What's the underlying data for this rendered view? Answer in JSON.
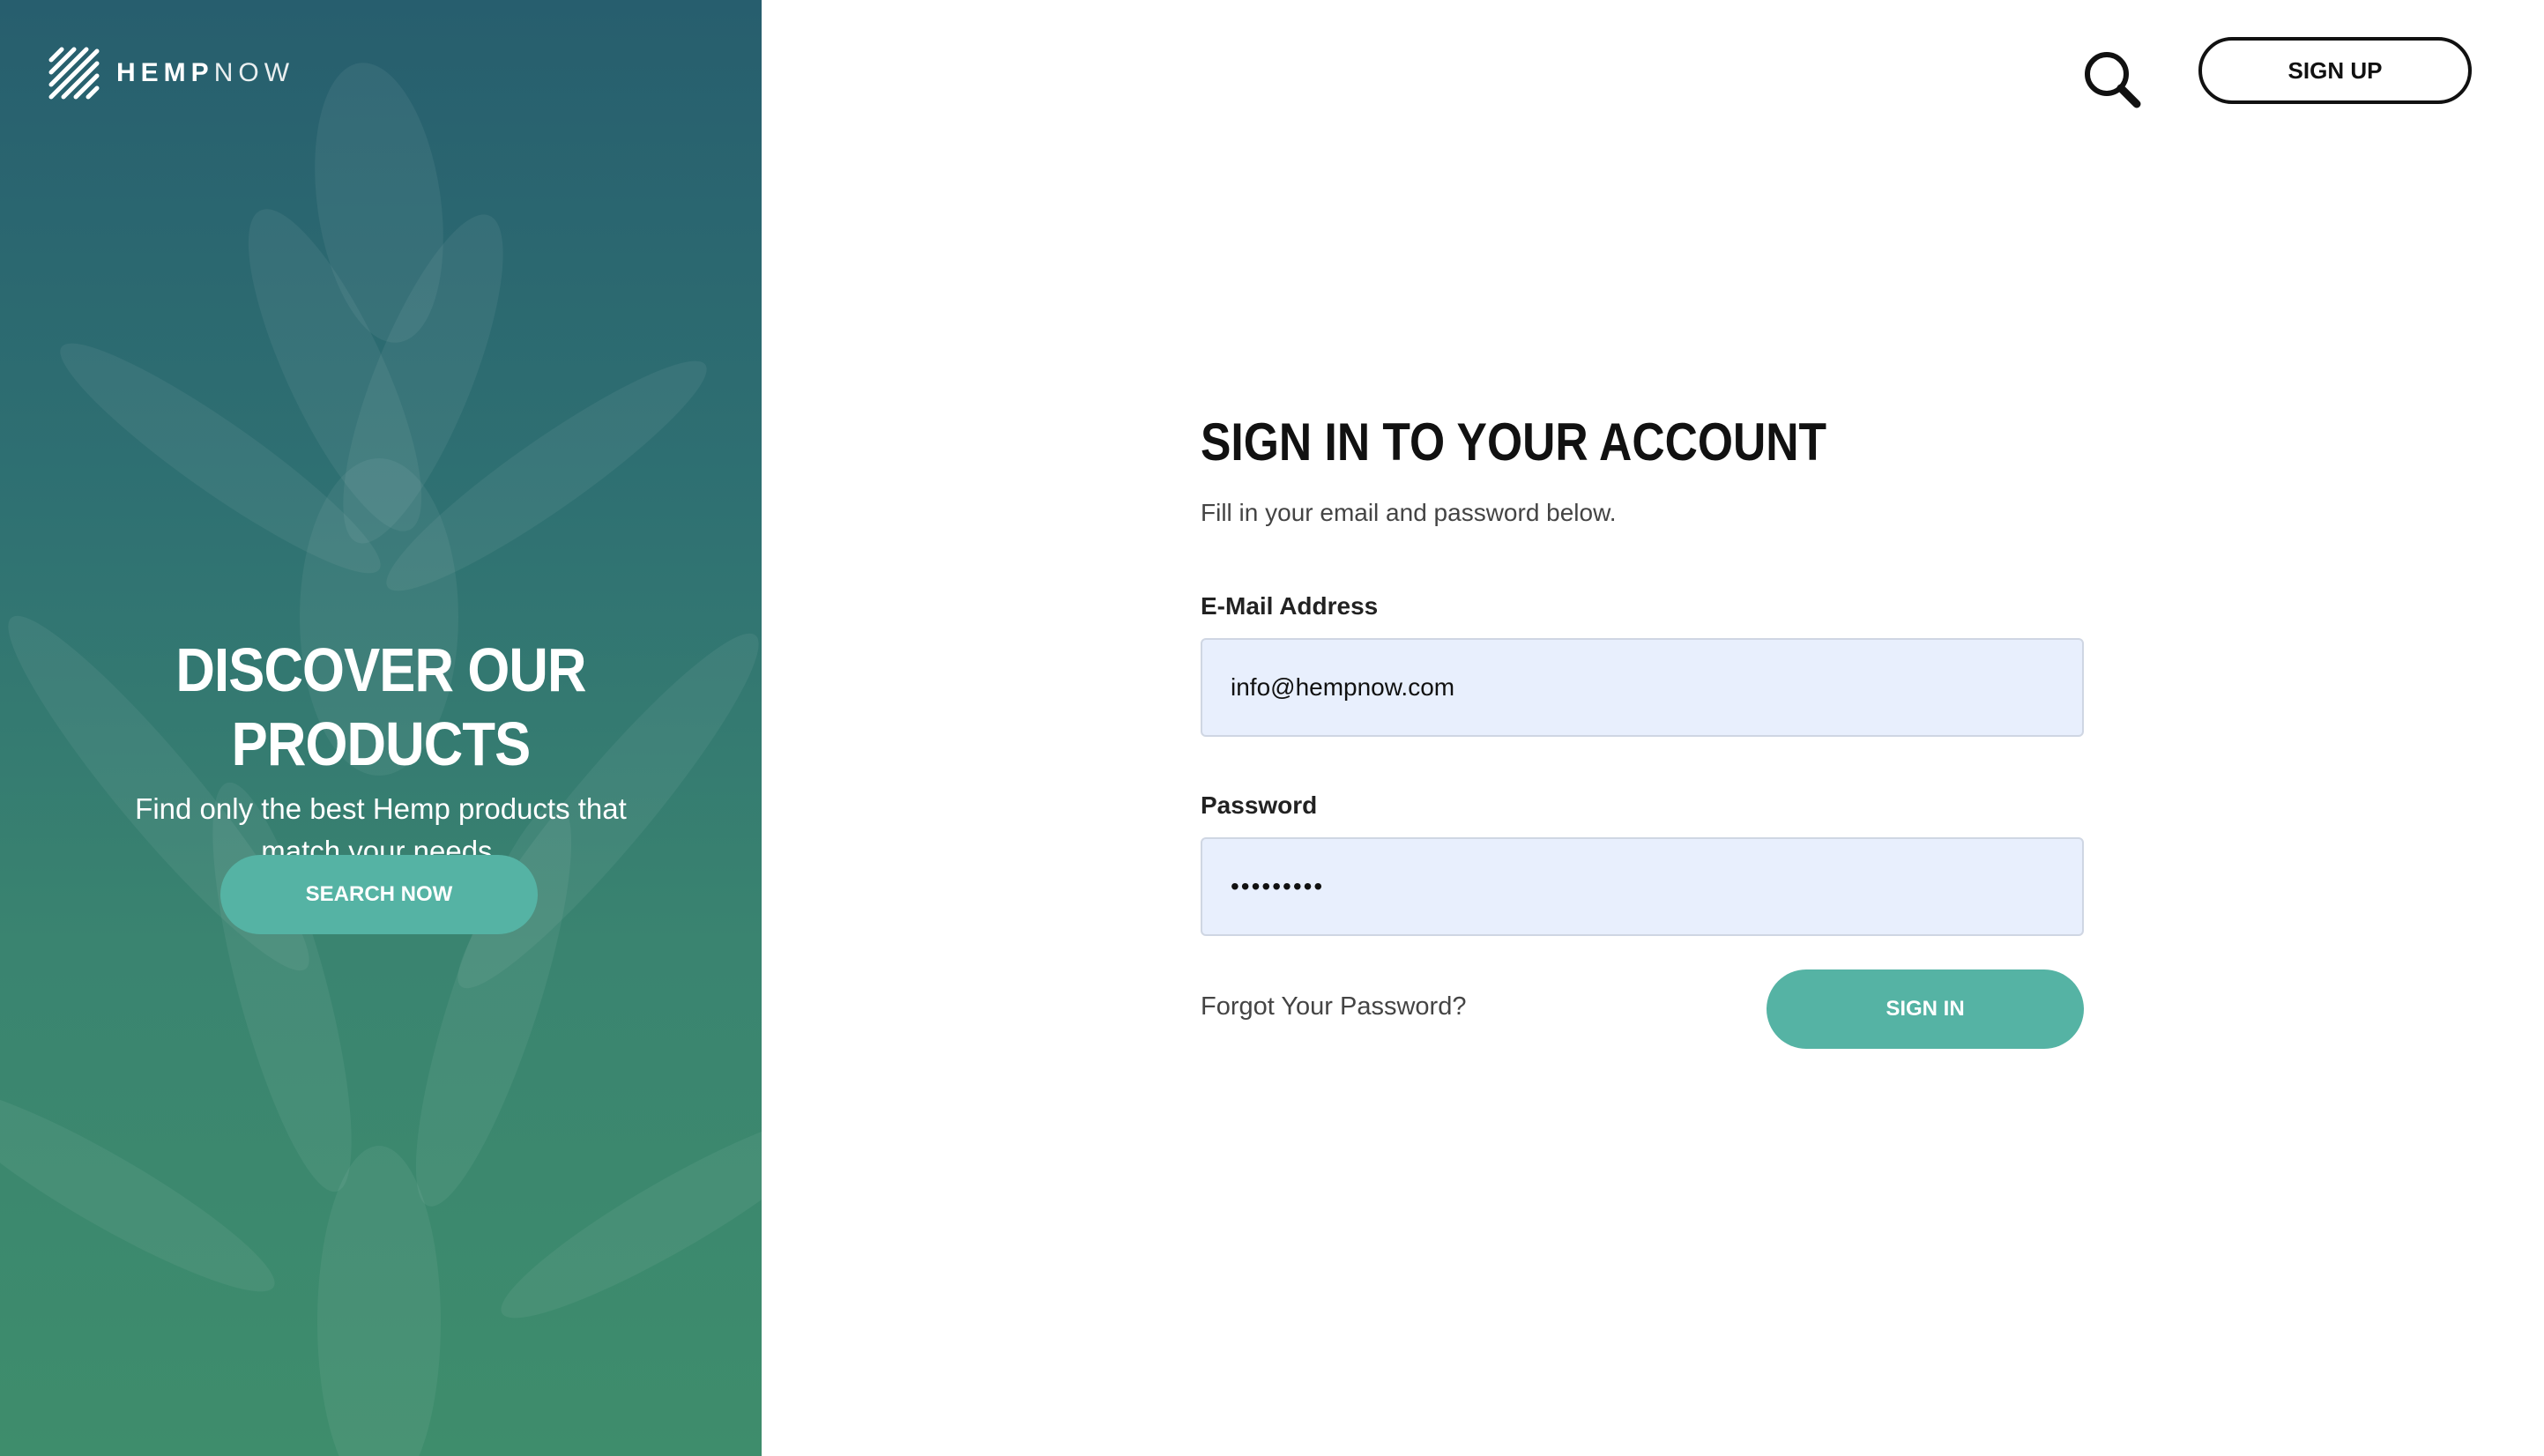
{
  "brand": {
    "name_bold": "HEMP",
    "name_light": "NOW",
    "logo_icon": "hempnow-stripes-logo"
  },
  "hero": {
    "title": "DISCOVER OUR PRODUCTS",
    "subtitle": "Find only the best Hemp products that match your needs.",
    "button_label": "SEARCH NOW"
  },
  "header": {
    "search_icon": "search-icon",
    "signup_label": "SIGN UP"
  },
  "form": {
    "title": "SIGN IN TO YOUR ACCOUNT",
    "subtitle": "Fill in your email and password below.",
    "email_label": "E-Mail Address",
    "email_value": "info@hempnow.com",
    "password_label": "Password",
    "password_value": "•••••••••",
    "forgot_label": "Forgot Your Password?",
    "signin_label": "SIGN IN"
  },
  "colors": {
    "accent": "#55b3a4",
    "hero_top": "#275e6e",
    "hero_bottom": "#3e8d6c",
    "input_bg": "#e8effd"
  }
}
